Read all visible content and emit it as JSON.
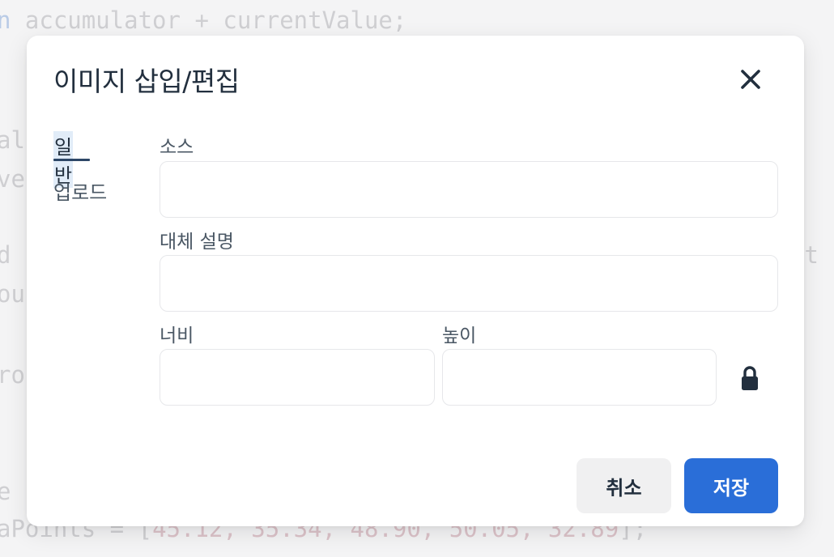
{
  "background_code": {
    "line1_a": "n ",
    "line1_b": "accumulator",
    "line1_c": " + ",
    "line1_d": "currentValue",
    "line1_e": ";",
    "line2": "al",
    "line3": "ve",
    "line4": "d",
    "line4_right": "ut",
    "line5": "ou",
    "line6": "ro",
    "line7": "e",
    "line8_a": "aPoints = [",
    "line8_b": "45.12, 35.34, 48.90, 50.05, 32.89",
    "line8_c": "];"
  },
  "dialog": {
    "title": "이미지 삽입/편집",
    "close_icon": "close-icon"
  },
  "tabs": [
    {
      "label": "일반",
      "active": true
    },
    {
      "label": "업로드",
      "active": false
    }
  ],
  "form": {
    "source_label": "소스",
    "source_value": "",
    "alt_label": "대체 설명",
    "alt_value": "",
    "width_label": "너비",
    "width_value": "",
    "height_label": "높이",
    "height_value": "",
    "lock_icon": "lock-icon"
  },
  "footer": {
    "cancel_label": "취소",
    "save_label": "저장"
  },
  "colors": {
    "primary": "#2a6ed8",
    "text": "#222f3e",
    "tab_highlight": "#e1ecf8"
  }
}
